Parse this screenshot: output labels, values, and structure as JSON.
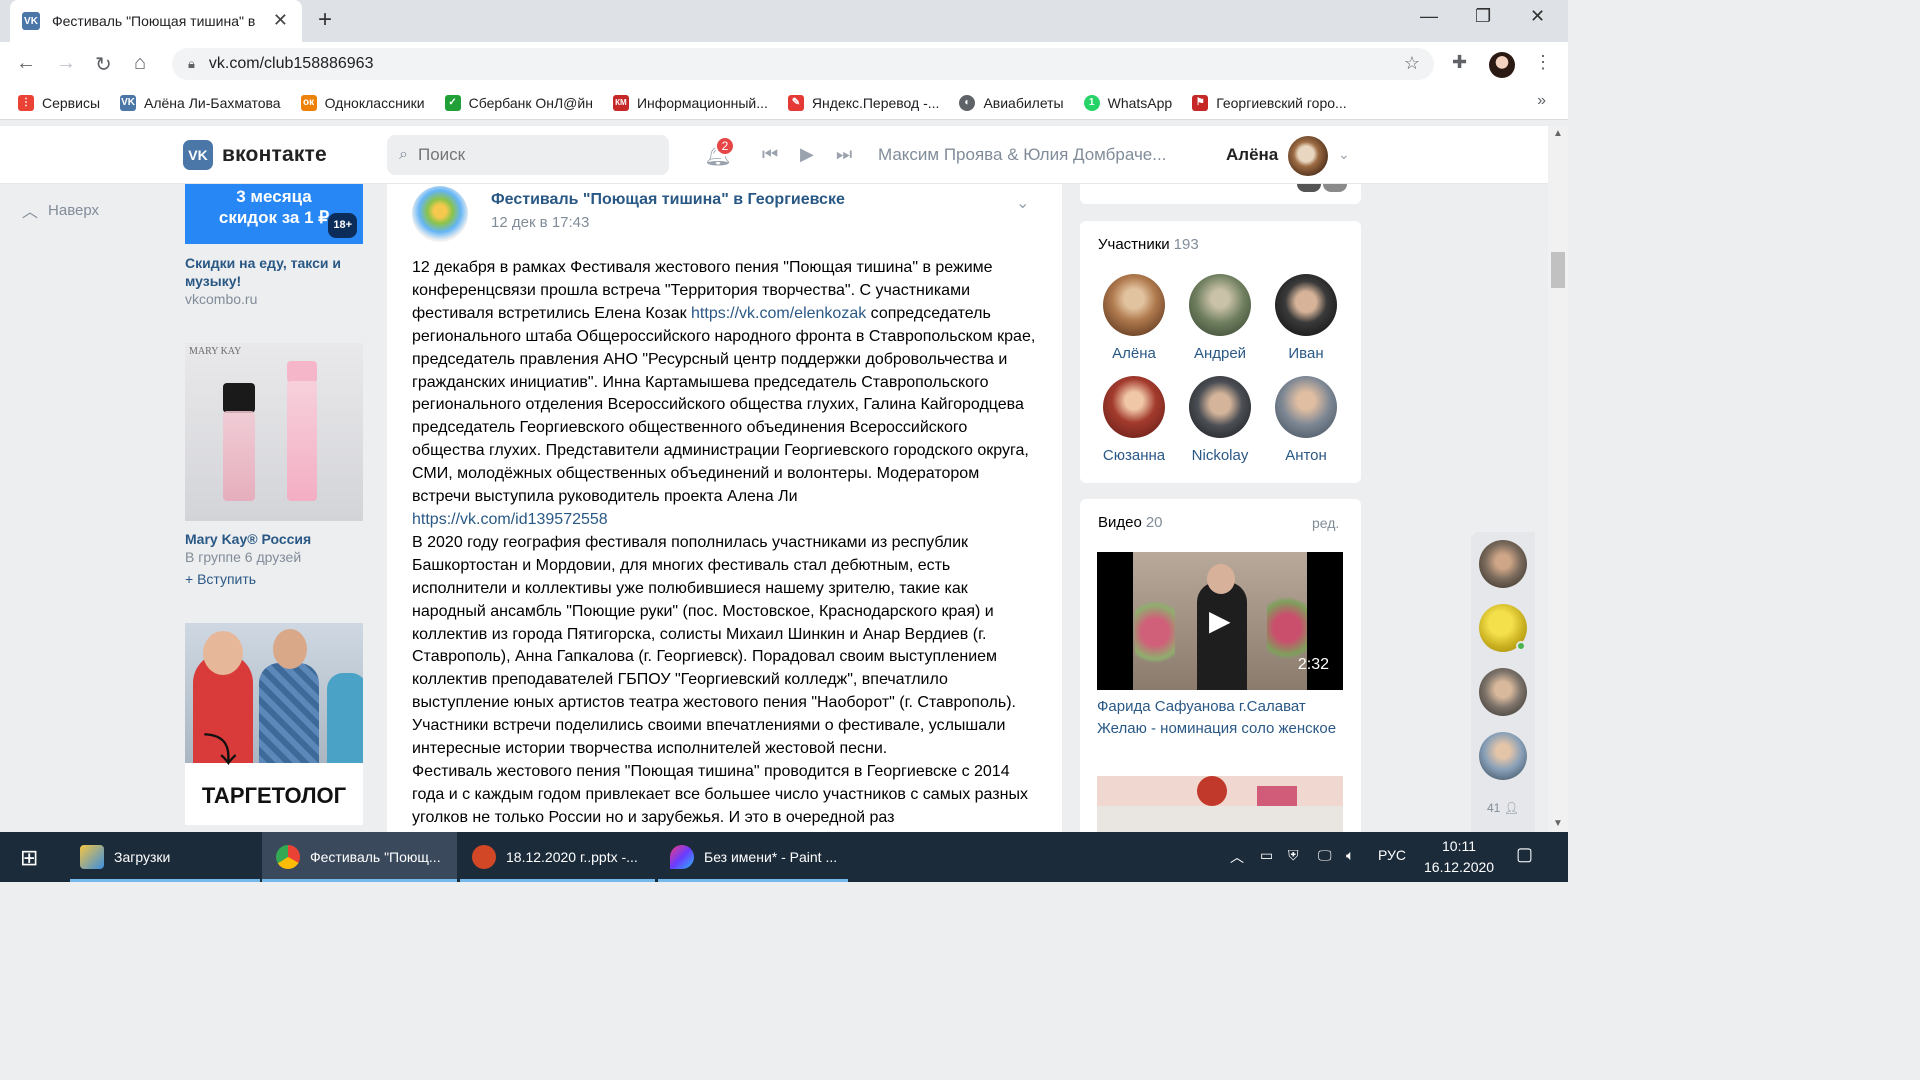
{
  "browser": {
    "tab_title": "Фестиваль \"Поющая тишина\" в",
    "url": "vk.com/club158886963",
    "bookmarks": [
      {
        "label": "Сервисы",
        "color": "#ea4335",
        "glyph": "⋮⋮"
      },
      {
        "label": "Алёна Ли-Бахматова",
        "color": "#4a76a8",
        "glyph": "VK"
      },
      {
        "label": "Одноклассники",
        "color": "#ee8208",
        "glyph": "ок"
      },
      {
        "label": "Сбербанк ОнЛ@йн",
        "color": "#21a038",
        "glyph": "✓"
      },
      {
        "label": "Информационный...",
        "color": "#c62828",
        "glyph": "КМ"
      },
      {
        "label": "Яндекс.Перевод -...",
        "color": "#e53935",
        "glyph": "✎"
      },
      {
        "label": "Авиабилеты",
        "color": "#5f6368",
        "glyph": "◐"
      },
      {
        "label": "WhatsApp",
        "color": "#25d366",
        "glyph": "1"
      },
      {
        "label": "Георгиевский горo...",
        "color": "#c62828",
        "glyph": "⚑"
      }
    ]
  },
  "vk": {
    "logo_text": "вконтакте",
    "search_placeholder": "Поиск",
    "notifications_count": "2",
    "track": "Максим Проява & Юлия Домбраче...",
    "user_name": "Алёна",
    "back_to_top": "Наверх"
  },
  "ads": {
    "ad1_line1": "3 месяца",
    "ad1_line2": "скидок за 1 ₽",
    "ad1_age": "18+",
    "ad1_title": "Скидки на еду, такси и музыку!",
    "ad1_domain": "vkcombo.ru",
    "ad2_brand_on_image": "MARY KAY",
    "ad2_title": "Mary Kay® Россия",
    "ad2_sub": "В группе 6 друзей",
    "ad2_join": "+ Вступить",
    "ad3_caption": "ТАРГЕТОЛОГ"
  },
  "post": {
    "author": "Фестиваль \"Поющая тишина\" в Георгиевске",
    "date": "12 дек в 17:43",
    "p1_a": "12 декабря в рамках Фестиваля жестового пения \"Поющая тишина\" в режиме конференцсвязи прошла встреча \"Территория творчества\". С участниками фестиваля встретились Елена Козак ",
    "link1": "https://vk.com/elenkozak",
    "p1_b": " сопредседатель регионального штаба Общероссийского народного фронта в Ставропольском крае, председатель правления АНО \"Ресурсный центр поддержки добровольчества и гражданских инициатив\". Инна Картамышева председатель Ставропольского регионального отделения Всероссийского общества глухих, Галина Кайгородцева председатель Георгиевского общественного объединения Всероссийского общества глухих. Представители администрации Георгиевского городского округа, СМИ, молодёжных общественных объединений и волонтеры. Модератором встречи выступила руководитель проекта Алена Ли",
    "link2": "https://vk.com/id139572558",
    "p2": "В 2020 году география фестиваля пополнилась участниками из республик Башкортостан и Мордовии, для многих фестиваль стал дебютным, есть исполнители и коллективы уже полюбившиеся нашему зрителю, такие как народный ансамбль \"Поющие руки\" (пос. Мостовское, Краснодарского края) и коллектив из города Пятигорска, солисты Михаил Шинкин и Анар Вердиев (г. Ставрополь), Анна Гапкалова (г. Георгиевск). Порадовал своим выступлением коллектив преподавателей ГБПОУ \"Георгиевский колледж\", впечатлило выступление юных артистов театра жестового пения \"Наоборот\" (г. Ставрополь). Участники встречи поделились своими впечатлениями о фестивале, услышали интересные истории творчества исполнителей жестовой песни.",
    "p3": "Фестиваль жестового пения \"Поющая тишина\" проводится в Георгиевске с 2014 года и с каждым годом привлекает все большее число участников с самых разных уголков не только России но и зарубежья. И это в очередной раз"
  },
  "members": {
    "title": "Участники",
    "count": "193",
    "list": [
      {
        "name": "Алёна",
        "color": "#b07a4e"
      },
      {
        "name": "Андрей",
        "color": "#6f7f5f"
      },
      {
        "name": "Иван",
        "color": "#3a3a3a"
      },
      {
        "name": "Сюзанна",
        "color": "#a33b2e"
      },
      {
        "name": "Nickolay",
        "color": "#4c4f55"
      },
      {
        "name": "Антон",
        "color": "#7d8794"
      }
    ]
  },
  "videos": {
    "title": "Видео",
    "count": "20",
    "edit": "ред.",
    "v1_duration": "2:32",
    "v1_title": "Фарида Сафуанова г.Салават Желаю - номинация соло женское"
  },
  "friends_sidebar": {
    "count": "41"
  },
  "taskbar": {
    "items": [
      "Загрузки",
      "Фестиваль \"Поющ...",
      "18.12.2020 г..pptx -...",
      "Без имени* - Paint ..."
    ],
    "lang": "РУС",
    "time": "10:11",
    "date": "16.12.2020"
  }
}
